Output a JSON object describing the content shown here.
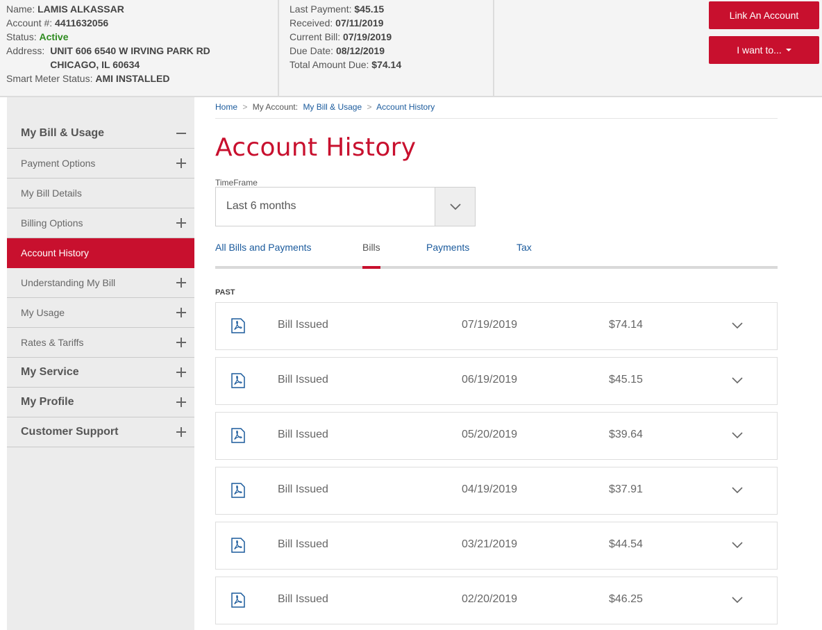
{
  "header": {
    "name_label": "Name:",
    "name_value": "LAMIS ALKASSAR",
    "account_label": "Account #:",
    "account_value": "4411632056",
    "status_label": "Status:",
    "status_value": "Active",
    "address_label": "Address:",
    "address_line1": "UNIT 606 6540 W IRVING PARK RD",
    "address_line2": "CHICAGO, IL 60634",
    "meter_label": "Smart Meter Status:",
    "meter_value": "AMI INSTALLED",
    "last_payment_label": "Last Payment:",
    "last_payment_value": "$45.15",
    "received_label": "Received:",
    "received_value": "07/11/2019",
    "current_bill_label": "Current Bill:",
    "current_bill_value": "07/19/2019",
    "due_date_label": "Due Date:",
    "due_date_value": "08/12/2019",
    "total_due_label": "Total Amount Due:",
    "total_due_value": "$74.14",
    "link_account_button": "Link An Account",
    "i_want_to_button": "I want to..."
  },
  "sidebar": {
    "items": [
      {
        "label": "My Bill & Usage",
        "icon": "minus-icon"
      },
      {
        "label": "Payment Options",
        "icon": "plus-icon"
      },
      {
        "label": "My Bill Details",
        "icon": ""
      },
      {
        "label": "Billing Options",
        "icon": "plus-icon"
      },
      {
        "label": "Account History",
        "icon": ""
      },
      {
        "label": "Understanding My Bill",
        "icon": "plus-icon"
      },
      {
        "label": "My Usage",
        "icon": "plus-icon"
      },
      {
        "label": "Rates & Tariffs",
        "icon": "plus-icon"
      },
      {
        "label": "My Service",
        "icon": "plus-icon"
      },
      {
        "label": "My Profile",
        "icon": "plus-icon"
      },
      {
        "label": "Customer Support",
        "icon": "plus-icon"
      }
    ]
  },
  "breadcrumb": {
    "home": "Home",
    "sep": ">",
    "my_account": "My Account:",
    "bill_usage": "My Bill & Usage",
    "current": "Account History"
  },
  "page": {
    "title": "Account History",
    "timeframe_label": "TimeFrame",
    "timeframe_value": "Last 6 months",
    "section_label": "PAST"
  },
  "tabs": [
    {
      "label": "All Bills and Payments"
    },
    {
      "label": "Bills"
    },
    {
      "label": "Payments"
    },
    {
      "label": "Tax"
    }
  ],
  "bills": [
    {
      "desc": "Bill Issued",
      "date": "07/19/2019",
      "amount": "$74.14"
    },
    {
      "desc": "Bill Issued",
      "date": "06/19/2019",
      "amount": "$45.15"
    },
    {
      "desc": "Bill Issued",
      "date": "05/20/2019",
      "amount": "$39.64"
    },
    {
      "desc": "Bill Issued",
      "date": "04/19/2019",
      "amount": "$37.91"
    },
    {
      "desc": "Bill Issued",
      "date": "03/21/2019",
      "amount": "$44.54"
    },
    {
      "desc": "Bill Issued",
      "date": "02/20/2019",
      "amount": "$46.25"
    }
  ],
  "colors": {
    "brand_red": "#c8102e",
    "link_blue": "#1a5a9c",
    "active_green": "#2e8b1f"
  }
}
